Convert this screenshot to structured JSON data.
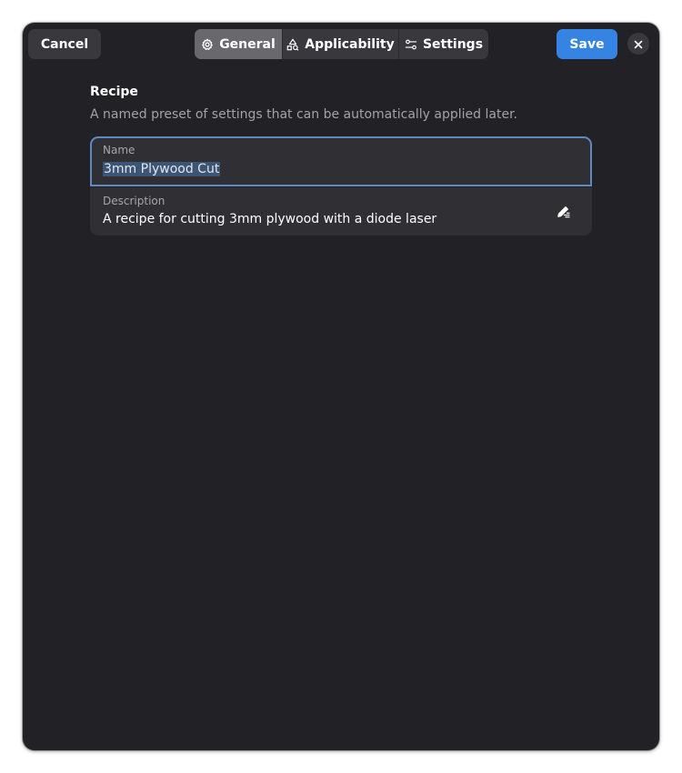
{
  "header": {
    "cancel_label": "Cancel",
    "save_label": "Save",
    "tabs": [
      {
        "label": "General",
        "icon": "gear-icon",
        "active": true
      },
      {
        "label": "Applicability",
        "icon": "shapes-icon",
        "active": false
      },
      {
        "label": "Settings",
        "icon": "sliders-icon",
        "active": false
      }
    ],
    "close_icon": "close-icon"
  },
  "recipe": {
    "title": "Recipe",
    "subtitle": "A named preset of settings that can be automatically applied later.",
    "name_label": "Name",
    "name_value": "3mm Plywood Cut",
    "description_label": "Description",
    "description_value": "A recipe for cutting 3mm plywood with a diode laser",
    "edit_icon": "edit-icon"
  },
  "colors": {
    "window_bg": "#222226",
    "button_bg": "#38383d",
    "accent": "#3584e4",
    "active_tab": "#68686d",
    "focus_border": "#5d8ac3"
  }
}
